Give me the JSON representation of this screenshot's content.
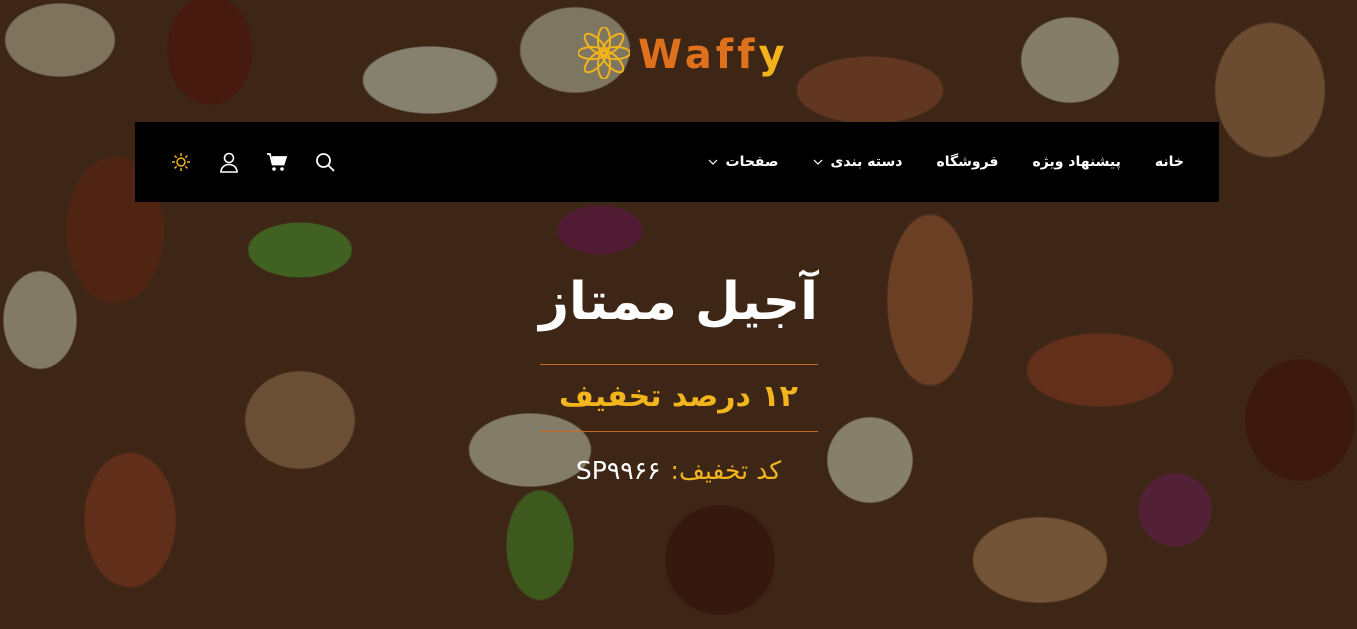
{
  "brand": {
    "name": "Waffy",
    "colors": {
      "primary": "#e0711c",
      "accent": "#f2b21b"
    },
    "logo_icon": "flower-icon"
  },
  "nav": {
    "items": [
      {
        "label": "خانه",
        "has_dropdown": false
      },
      {
        "label": "پیشنهاد ویژه",
        "has_dropdown": false
      },
      {
        "label": "فروشگاه",
        "has_dropdown": false
      },
      {
        "label": "دسته بندی",
        "has_dropdown": true
      },
      {
        "label": "صفحات",
        "has_dropdown": true
      }
    ],
    "icons": [
      "search-icon",
      "cart-icon",
      "user-icon",
      "sun-icon"
    ],
    "background": "#000000"
  },
  "hero": {
    "title": "آجیل ممتاز",
    "discount": "۱۲ درصد تخفیف",
    "code_label": "کد تخفیف:",
    "code_value": "SP۹۹۶۶",
    "colors": {
      "title": "#ffffff",
      "highlight": "#f3b51d",
      "divider": "#c96a1e"
    }
  }
}
